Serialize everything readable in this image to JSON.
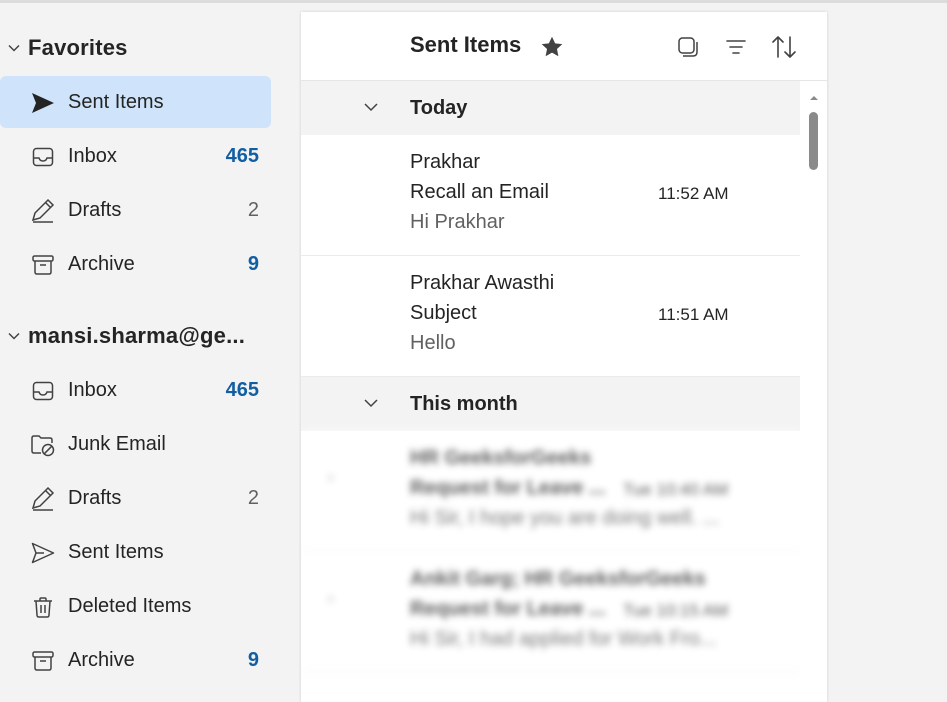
{
  "favorites": {
    "title": "Favorites",
    "items": [
      {
        "label": "Sent Items",
        "icon": "send-filled-icon",
        "count": ""
      },
      {
        "label": "Inbox",
        "icon": "inbox-icon",
        "count": "465"
      },
      {
        "label": "Drafts",
        "icon": "drafts-icon",
        "count": "2"
      },
      {
        "label": "Archive",
        "icon": "archive-icon",
        "count": "9"
      }
    ]
  },
  "account": {
    "title": "mansi.sharma@ge...",
    "items": [
      {
        "label": "Inbox",
        "icon": "inbox-icon",
        "count": "465"
      },
      {
        "label": "Junk Email",
        "icon": "junk-folder-icon",
        "count": ""
      },
      {
        "label": "Drafts",
        "icon": "drafts-icon",
        "count": "2"
      },
      {
        "label": "Sent Items",
        "icon": "send-outline-icon",
        "count": ""
      },
      {
        "label": "Deleted Items",
        "icon": "trash-icon",
        "count": ""
      },
      {
        "label": "Archive",
        "icon": "archive-icon",
        "count": "9"
      }
    ]
  },
  "panel": {
    "title": "Sent Items",
    "actions": [
      "favorite-star-icon",
      "select-icon",
      "filter-icon",
      "sort-icon"
    ]
  },
  "sections": {
    "today": "Today",
    "this_month": "This month"
  },
  "messages": [
    {
      "sender": "Prakhar",
      "subject": "Recall an Email",
      "time": "11:52 AM",
      "preview": "Hi Prakhar"
    },
    {
      "sender": "Prakhar Awasthi",
      "subject": "Subject",
      "time": "11:51 AM",
      "preview": "Hello"
    }
  ],
  "blurred_messages": [
    {
      "sender": "HR GeeksforGeeks",
      "subject": "Request for Leave ...",
      "time": "Tue 10:40 AM",
      "preview": "Hi Sir, I hope you are doing well. ...",
      "bullet": "›"
    },
    {
      "sender": "Ankit Garg; HR GeeksforGeeks",
      "subject": "Request for Leave ...",
      "time": "Tue 10:15 AM",
      "preview": "Hi Sir, I had applied for Work Fro...",
      "bullet": "›"
    }
  ],
  "colors": {
    "selected_bg": "#cfe4fa",
    "unread_count": "#115ea3",
    "panel_bg": "#ffffff",
    "app_bg": "#f3f3f3"
  }
}
